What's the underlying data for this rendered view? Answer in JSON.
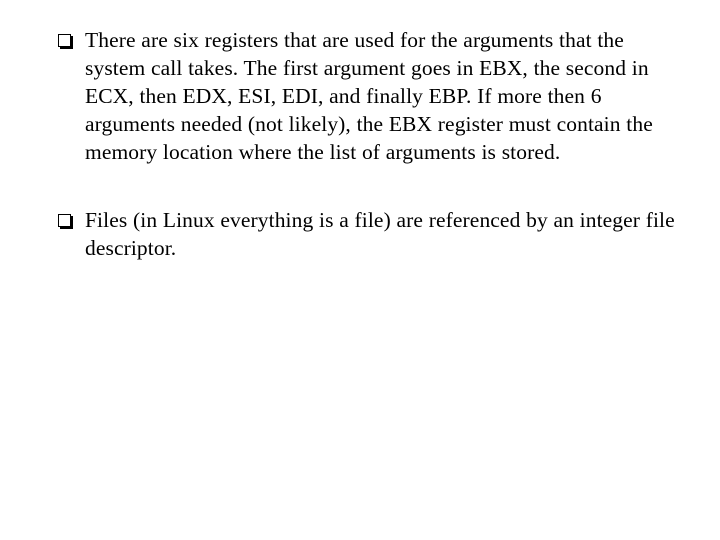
{
  "slide": {
    "background_color": "#ffffff",
    "text_color": "#000000",
    "bullet_glyph": "shadowed-open-square",
    "bullets": [
      {
        "text": "There are six registers that are used for the arguments that the system call takes. The first argument goes in EBX, the second in ECX, then EDX, ESI, EDI, and finally EBP. If more then 6 arguments needed (not likely), the EBX register must contain the memory location where the list of arguments is stored."
      },
      {
        "text": "Files (in Linux everything is a file) are referenced by an integer file descriptor."
      }
    ]
  }
}
